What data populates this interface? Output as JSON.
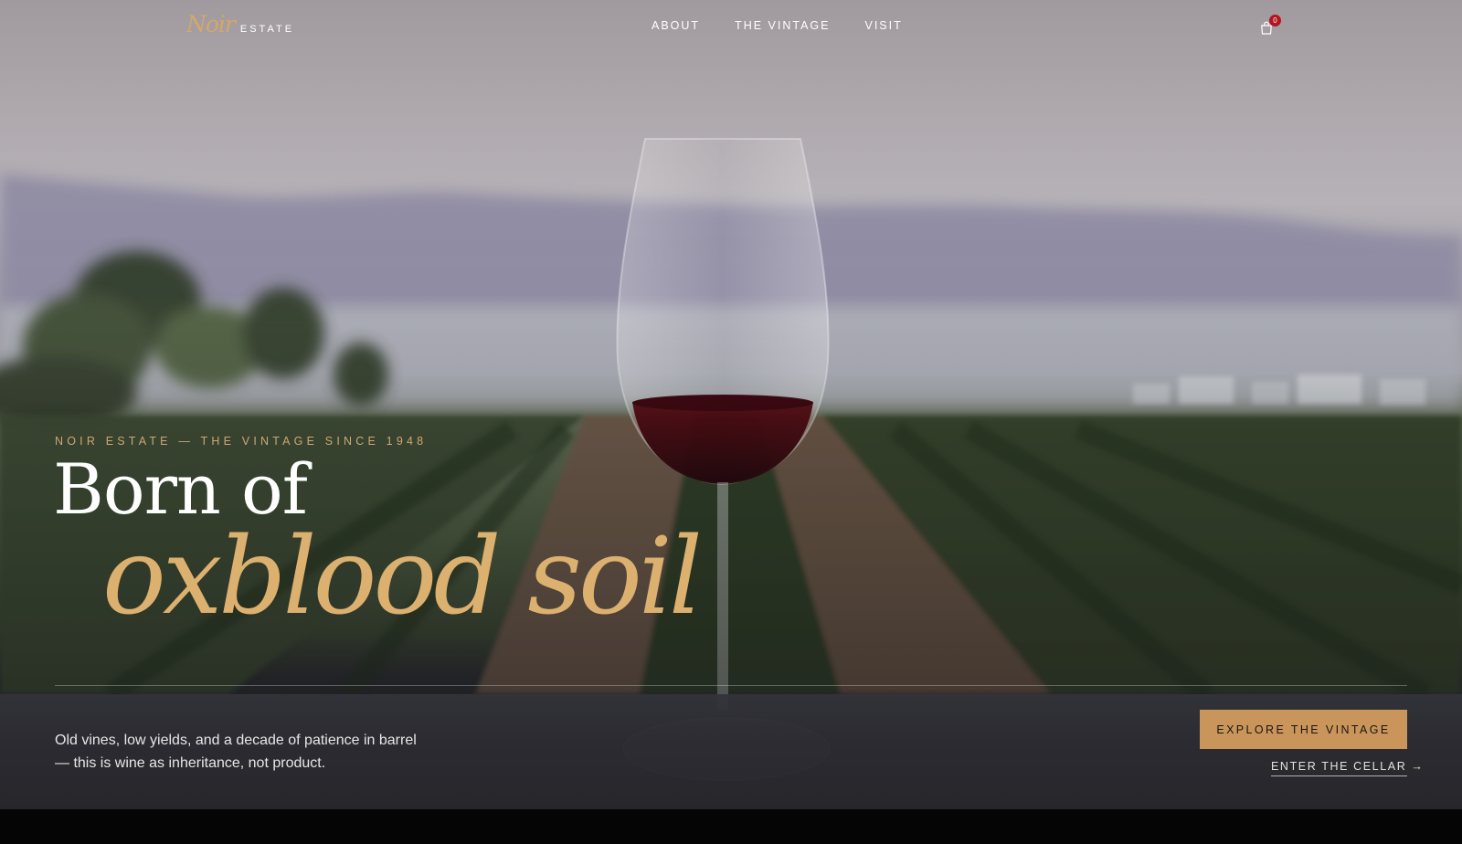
{
  "brand": {
    "script": "Noir",
    "word": "ESTATE"
  },
  "nav": {
    "items": [
      "ABOUT",
      "THE VINTAGE",
      "VISIT"
    ]
  },
  "cart": {
    "count": "0",
    "icon": "shopping-bag-icon"
  },
  "hero": {
    "eyebrow": "NOIR ESTATE — THE VINTAGE SINCE 1948",
    "headline_line1": "Born of",
    "headline_line2": "oxblood soil",
    "body": "Old vines, low yields, and a decade of patience in barrel — this is wine as inheritance, not product.",
    "cta_primary": "EXPLORE THE VINTAGE",
    "cta_secondary": "ENTER THE CELLAR →"
  },
  "colors": {
    "accent_gold": "#c9955a",
    "headline_gold": "#dcb06f",
    "badge_red": "#b3151f"
  }
}
